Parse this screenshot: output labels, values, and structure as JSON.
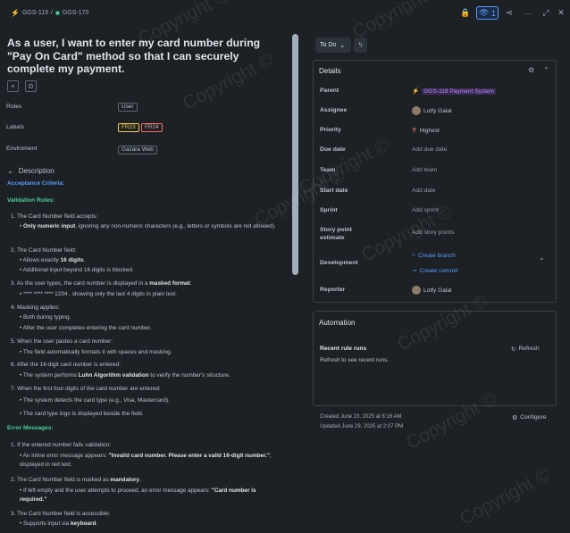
{
  "breadcrumb": {
    "parent": "GGS-119",
    "separator": "/",
    "current": "GGS-170"
  },
  "title": "As a user, I want to enter my card number during \"Pay On Card\" method so that I can securely complete my payment.",
  "fields": {
    "roles_label": "Roles",
    "roles_value": "User",
    "labels_label": "Labels",
    "labels": [
      "FR23",
      "FR24"
    ],
    "environment_label": "Enviroment",
    "environment_value": "Gazara Web"
  },
  "description": {
    "heading": "Description",
    "acceptance": "Acceptance Criteria:",
    "validation": "Validation Rules:",
    "i1": "1. The Card Number field accepts:",
    "i1a_b": "Only numeric input",
    "i1a": ", ignoring any non-numeric characters (e.g., letters or symbols are not allowed).",
    "i2": "2. The Card Number field:",
    "i2a_pre": "Allows exactly ",
    "i2a_b": "16 digits",
    "i2b": "Additional input beyond 16 digits is blocked.",
    "i3_pre": "3. As the user types, the card number is displayed in a ",
    "i3_b": "masked format",
    "i3a": "**** **** **** 1234 , showing only the last 4 digits in plain text.",
    "i4": "4. Masking applies:",
    "i4a": "Both during typing.",
    "i4b": "After the user completes entering the card number.",
    "i5": "5. When the user pastes a card number:",
    "i5a": "The field automatically formats it with spaces and masking.",
    "i6": "6. After the 16-digit card number is entered:",
    "i6a_pre": "The system performs ",
    "i6a_b": "Luhn Algorithm validation",
    "i6a_post": " to verify the number's structure.",
    "i7": "7. When the first four digits of the card number are entered:",
    "i7a": "The system detects the card type (e.g., Visa, Mastercard).",
    "i7b": "The card type logo is displayed beside the field.",
    "errors": "Error Messages:",
    "e1": "1. If the entered number fails validation:",
    "e1a_pre": "An inline error message appears: ",
    "e1a_b": "\"Invalid card number. Please enter a valid 16-digit number.\"",
    "e1a_post": ", displayed in red text.",
    "e2_pre": "2. The Card Number field is marked as ",
    "e2_b": "mandatory",
    "e2a_pre": "If left empty and the user attempts to proceed, an error message appears: ",
    "e2a_b": "\"Card number is required.\"",
    "e3": "3. The Card Number field is accessible:",
    "e3a_pre": "Supports input via ",
    "e3a_b": "keyboard"
  },
  "status": {
    "label": "To Do"
  },
  "details": {
    "heading": "Details",
    "rows": [
      {
        "label": "Parent",
        "value": "GGS-119 Payment System"
      },
      {
        "label": "Assignee",
        "value": "Lotfy Galal"
      },
      {
        "label": "Priority",
        "value": "Highest"
      },
      {
        "label": "Due date",
        "value": "Add due date"
      },
      {
        "label": "Team",
        "value": "Add team"
      },
      {
        "label": "Start date",
        "value": "Add date"
      },
      {
        "label": "Sprint",
        "value": "Add sprint"
      },
      {
        "label": "Story point estimate",
        "value": "Add story points"
      },
      {
        "label": "Development",
        "value": "Create branch",
        "value2": "Create commit"
      },
      {
        "label": "Reporter",
        "value": "Lotfy Galal"
      }
    ]
  },
  "automation": {
    "heading": "Automation",
    "recent": "Recent rule runs",
    "refresh": "Refresh",
    "hint": "Refresh to see recent runs."
  },
  "footer": {
    "created": "Created June 23, 2025 at 8:16 AM",
    "updated": "Updated June 29, 2025 at 2:07 PM",
    "configure": "Configure"
  },
  "watch_count": "1",
  "watermark": "Copyright ©",
  "colors": {
    "accent": "#579dff",
    "parent_tag": "#b38cf5",
    "priority": "#f87168",
    "label1": "#f5cd47",
    "label2": "#f87168"
  }
}
